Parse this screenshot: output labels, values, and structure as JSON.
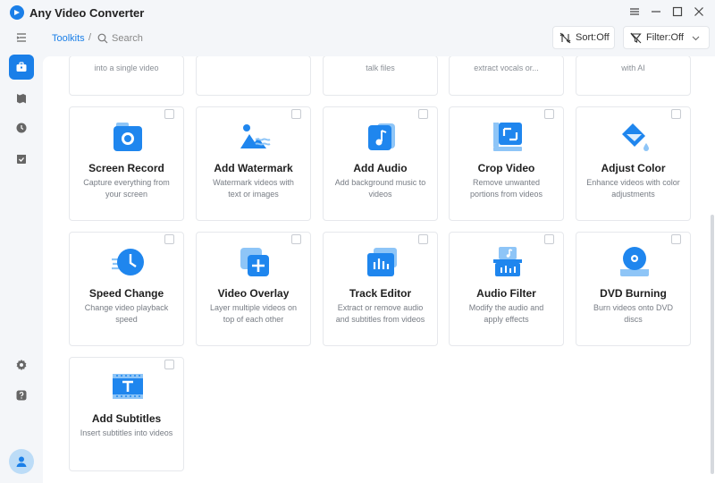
{
  "app": {
    "title": "Any Video Converter",
    "accent": "#1a7fe8"
  },
  "window_controls": [
    "menu-icon",
    "minimize-icon",
    "maximize-icon",
    "close-icon"
  ],
  "sidebar": {
    "items": [
      {
        "name": "collapse-menu-icon",
        "active": false
      },
      {
        "name": "toolkit-icon",
        "active": true
      },
      {
        "name": "library-icon",
        "active": false
      },
      {
        "name": "history-icon",
        "active": false
      },
      {
        "name": "tasks-icon",
        "active": false
      }
    ],
    "bottom": [
      "settings-icon",
      "help-icon",
      "user-avatar"
    ]
  },
  "toolbar": {
    "breadcrumb": "Toolkits",
    "separator": "/",
    "search_placeholder": "Search",
    "sort_label": "Sort:Off",
    "filter_label": "Filter:Off"
  },
  "partial_row": [
    {
      "desc": "into a single video"
    },
    {
      "desc": ""
    },
    {
      "desc": "talk files"
    },
    {
      "desc": "extract vocals or..."
    },
    {
      "desc": "with AI"
    }
  ],
  "tools": [
    {
      "title": "Screen Record",
      "desc": "Capture everything from your screen",
      "icon": "screen-record-icon"
    },
    {
      "title": "Add Watermark",
      "desc": "Watermark videos with text or images",
      "icon": "watermark-icon"
    },
    {
      "title": "Add Audio",
      "desc": "Add background music to videos",
      "icon": "music-note-icon"
    },
    {
      "title": "Crop Video",
      "desc": "Remove unwanted portions from videos",
      "icon": "crop-icon"
    },
    {
      "title": "Adjust Color",
      "desc": "Enhance videos with color adjustments",
      "icon": "paint-bucket-icon"
    },
    {
      "title": "Speed Change",
      "desc": "Change video playback speed",
      "icon": "speed-clock-icon"
    },
    {
      "title": "Video Overlay",
      "desc": "Layer multiple videos on top of each other",
      "icon": "overlay-plus-icon"
    },
    {
      "title": "Track Editor",
      "desc": "Extract or remove audio and subtitles from videos",
      "icon": "audio-track-icon"
    },
    {
      "title": "Audio Filter",
      "desc": "Modify the audio and apply effects",
      "icon": "audio-filter-icon"
    },
    {
      "title": "DVD Burning",
      "desc": "Burn videos onto DVD discs",
      "icon": "dvd-disc-icon"
    },
    {
      "title": "Add Subtitles",
      "desc": "Insert subtitles into videos",
      "icon": "subtitles-icon"
    }
  ]
}
